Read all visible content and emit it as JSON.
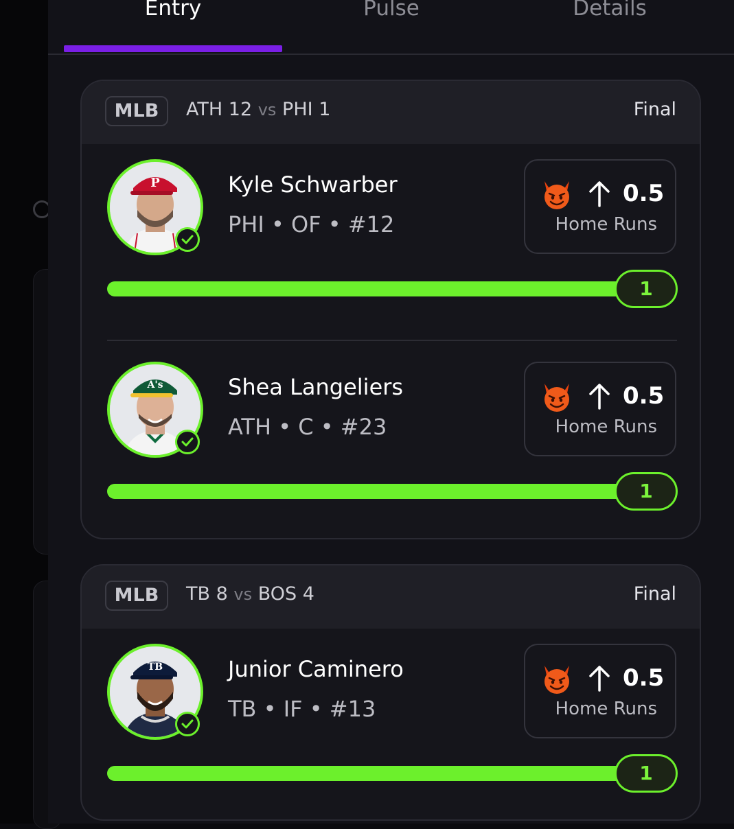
{
  "tabs": [
    {
      "label": "Entry",
      "active": true
    },
    {
      "label": "Pulse",
      "active": false
    },
    {
      "label": "Details",
      "active": false
    }
  ],
  "colors": {
    "accent_purple": "#7a1fe6",
    "progress_green": "#6cf02c",
    "background": "#121218"
  },
  "games": [
    {
      "league": "MLB",
      "away_team": "ATH",
      "away_score": "12",
      "vs": "vs",
      "home_team": "PHI",
      "home_score": "1",
      "status": "Final",
      "picks": [
        {
          "name": "Kyle Schwarber",
          "meta": "PHI • OF • #12",
          "icon": "devil-emoji",
          "direction": "up-arrow-icon",
          "line": "0.5",
          "stat": "Home Runs",
          "result": "1",
          "progress": 1.0
        },
        {
          "name": "Shea Langeliers",
          "meta": "ATH • C • #23",
          "icon": "devil-emoji",
          "direction": "up-arrow-icon",
          "line": "0.5",
          "stat": "Home Runs",
          "result": "1",
          "progress": 1.0
        }
      ]
    },
    {
      "league": "MLB",
      "away_team": "TB",
      "away_score": "8",
      "vs": "vs",
      "home_team": "BOS",
      "home_score": "4",
      "status": "Final",
      "picks": [
        {
          "name": "Junior Caminero",
          "meta": "TB • IF • #13",
          "icon": "devil-emoji",
          "direction": "up-arrow-icon",
          "line": "0.5",
          "stat": "Home Runs",
          "result": "1",
          "progress": 1.0
        }
      ]
    }
  ]
}
